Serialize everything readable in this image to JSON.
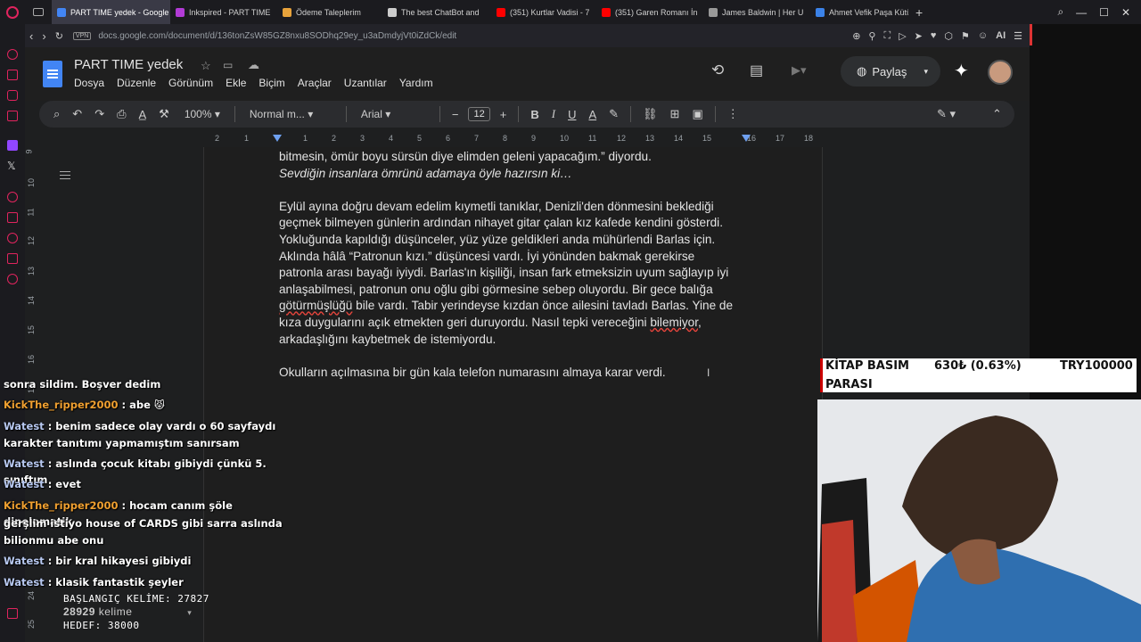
{
  "browser": {
    "tabs": [
      {
        "label": "PART TIME yedek - Google",
        "color": "#4285f4",
        "active": true
      },
      {
        "label": "Inkspired - PART TIME",
        "color": "#b23bd6",
        "active": false
      },
      {
        "label": "Ödeme Taleplerim",
        "color": "#e8a33b",
        "active": false
      },
      {
        "label": "The best ChatBot and",
        "color": "#cccccc",
        "active": false
      },
      {
        "label": "(351) Kurtlar Vadisi - 7",
        "color": "#ff0000",
        "active": false
      },
      {
        "label": "(351) Garen Romanı İn",
        "color": "#ff0000",
        "active": false
      },
      {
        "label": "James Baldwin | Her U",
        "color": "#999999",
        "active": false
      },
      {
        "label": "Ahmet Vefik Paşa Kütü",
        "color": "#3b82e8",
        "active": false
      }
    ],
    "new_tab": "+",
    "vpn": "VPN",
    "url": "docs.google.com/document/d/136tonZsW85GZ8nxu8SODhq29ey_u3aDmdyjVt0iZdCk/edit",
    "ai_label": "AI"
  },
  "docs": {
    "title": "PART TIME yedek",
    "menu": [
      "Dosya",
      "Düzenle",
      "Görünüm",
      "Ekle",
      "Biçim",
      "Araçlar",
      "Uzantılar",
      "Yardım"
    ],
    "share_label": "Paylaş",
    "toolbar": {
      "zoom": "100%",
      "style": "Normal m...",
      "font": "Arial",
      "font_size": "12"
    },
    "ruler_h": [
      "2",
      "1",
      "1",
      "2",
      "3",
      "4",
      "5",
      "6",
      "7",
      "8",
      "9",
      "10",
      "11",
      "12",
      "13",
      "14",
      "15",
      "16",
      "17",
      "18"
    ],
    "ruler_v": [
      "9",
      "10",
      "11",
      "12",
      "13",
      "14",
      "15",
      "16",
      "17",
      "24",
      "25"
    ],
    "paragraphs": {
      "p1a": "bitmesin, ömür boyu sürsün diye elimden geleni yapacağım.” diyordu.",
      "p1b": "Sevdiğin insanlara ömrünü adamaya öyle hazırsın ki…",
      "p2_l1": "Eylül ayına doğru devam edelim kıymetli tanıklar, Denizli'den dönmesini beklediği",
      "p2_l2": "geçmek bilmeyen günlerin ardından nihayet gitar çalan kız kafede kendini gösterdi.",
      "p2_l3": "Yokluğunda kapıldığı düşünceler, yüz yüze geldikleri anda mühürlendi Barlas için.",
      "p2_l4": "Aklında hâlâ “Patronun kızı.” düşüncesi vardı. İyi yönünden bakmak gerekirse",
      "p2_l5": "patronla arası bayağı iyiydi. Barlas'ın kişiliği, insan fark etmeksizin uyum sağlayıp iyi",
      "p2_l6": "anlaşabilmesi, patronun onu oğlu gibi görmesine sebep oluyordu. Bir gece balığa",
      "p2_l7_w": "götürmüşlüğü",
      "p2_l7": " bile vardı. Tabir yerindeyse kızdan önce ailesini tavladı Barlas. Yine de",
      "p2_l8": "kıza duygularını açık etmekten geri duruyordu. Nasıl tepki vereceğini ",
      "p2_l8_w": "bilemiyor",
      "p2_l8_end": ",",
      "p2_l9": "arkadaşlığını kaybetmek de istemiyordu.",
      "p3": "Okulların açılmasına bir gün kala telefon numarasını almaya karar verdi."
    }
  },
  "overlay": {
    "kitap_label_1": "KİTAP BASIM",
    "kitap_label_2": "PARASI",
    "kitap_value": "630₺ (0.63%)",
    "kitap_target": "TRY100000"
  },
  "chat": [
    {
      "user": "",
      "text": "sonra sildim. Boşver dedim"
    },
    {
      "user": "KickThe_ripper2000",
      "text": " : abe 😾"
    },
    {
      "user": "Watest",
      "text": " : benim sadece olay vardı o 60 sayfaydı"
    },
    {
      "user": "",
      "text": "karakter tanıtımı yapmamıştım sanırsam"
    },
    {
      "user": "Watest",
      "text": " : aslında çocuk kitabı gibiydi çünkü 5. sınıftım"
    },
    {
      "user": "Watest",
      "text": " : evet"
    },
    {
      "user": "KickThe_ripper2000",
      "text": " : hocam canım şöle dipolomatik"
    },
    {
      "user": "",
      "text": "gerşlim istiyo house of CARDS gibi sarra aslında"
    },
    {
      "user": "",
      "text": "bilionmu abe onu"
    },
    {
      "user": "Watest",
      "text": " : bir kral hikayesi gibiydi"
    },
    {
      "user": "Watest",
      "text": " : klasik fantastik şeyler"
    }
  ],
  "counters": {
    "start": "BAŞLANGIÇ KELİME: 27827",
    "words": "28929",
    "words_unit": "kelime",
    "target": "HEDEF: 38000"
  }
}
